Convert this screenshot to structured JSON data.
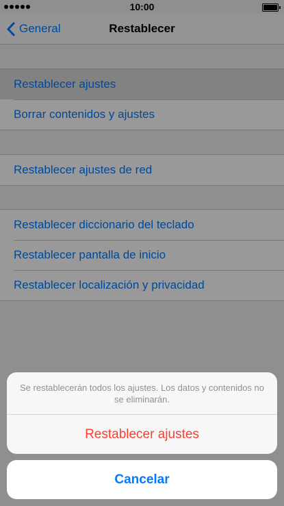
{
  "status_bar": {
    "time": "10:00"
  },
  "nav": {
    "back_label": "General",
    "title": "Restablecer"
  },
  "groups": [
    {
      "items": [
        {
          "label": "Restablecer ajustes"
        },
        {
          "label": "Borrar contenidos y ajustes"
        }
      ]
    },
    {
      "items": [
        {
          "label": "Restablecer ajustes de red"
        }
      ]
    },
    {
      "items": [
        {
          "label": "Restablecer diccionario del teclado"
        },
        {
          "label": "Restablecer pantalla de inicio"
        },
        {
          "label": "Restablecer localización y privacidad"
        }
      ]
    }
  ],
  "action_sheet": {
    "message": "Se restablecerán todos los ajustes. Los datos y contenidos no se eliminarán.",
    "confirm_label": "Restablecer ajustes",
    "cancel_label": "Cancelar"
  },
  "colors": {
    "accent": "#007aff",
    "destructive": "#ff3b30"
  }
}
